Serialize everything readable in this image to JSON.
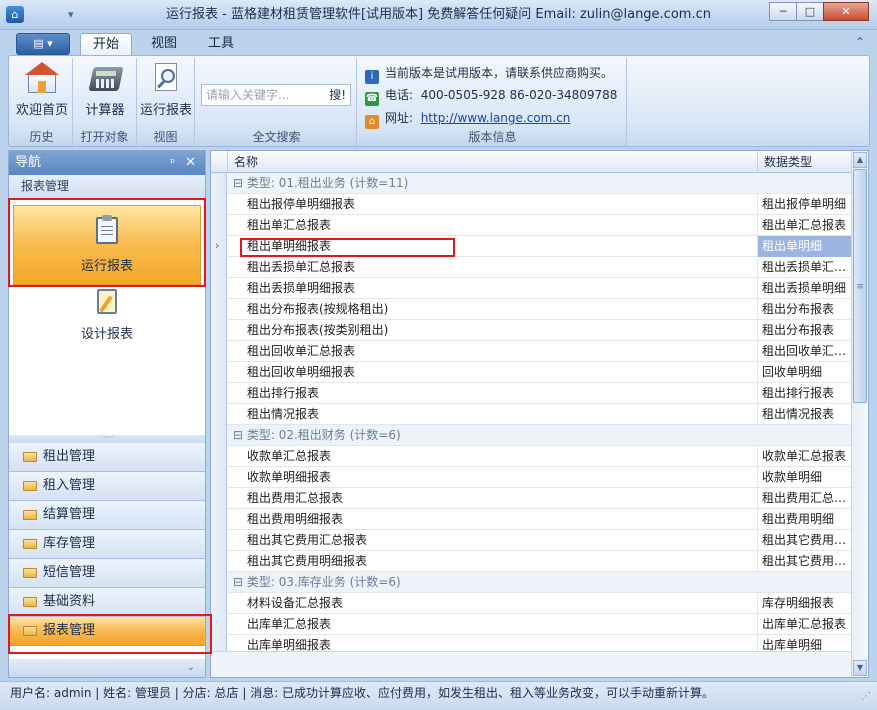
{
  "window": {
    "title": "运行报表 - 蓝格建材租赁管理软件[试用版本] 免费解答任何疑问 Email: zulin@lange.com.cn",
    "qat_symbol": "▾",
    "min_symbol": "─",
    "max_symbol": "□",
    "close_symbol": "✕"
  },
  "ribbon": {
    "app_menu_symbol": "▤ ▾",
    "tabs": [
      "开始",
      "视图",
      "工具"
    ],
    "collapse_symbol": "⌃",
    "groups": {
      "history": {
        "label": "历史",
        "button": "欢迎首页"
      },
      "open": {
        "label": "打开对象",
        "button": "计算器"
      },
      "view": {
        "label": "视图",
        "button": "运行报表"
      },
      "search": {
        "label": "全文搜索",
        "placeholder": "请输入关键字...",
        "go": "搜!"
      },
      "version": {
        "label": "版本信息",
        "notice": "当前版本是试用版本，请联系供应商购买。",
        "phone_label": "电话:",
        "phone_value": "400-0505-928  86-020-34809788",
        "site_label": "网址:",
        "site_value": "http://www.lange.com.cn"
      }
    }
  },
  "nav": {
    "title": "导航",
    "pin_symbol": "ᵖ",
    "close_symbol": "✕",
    "section": "报表管理",
    "big_items": [
      "运行报表",
      "设计报表"
    ],
    "splitter": "·····",
    "categories": [
      "租出管理",
      "租入管理",
      "结算管理",
      "库存管理",
      "短信管理",
      "基础资料",
      "报表管理"
    ],
    "more_symbol": "⌄"
  },
  "grid": {
    "columns": [
      "名称",
      "数据类型"
    ],
    "pointer": "›",
    "rows": [
      {
        "kind": "group",
        "name": "⊟ 类型: 01.租出业务 (计数=11)"
      },
      {
        "name": "租出报停单明细报表",
        "type": "租出报停单明细"
      },
      {
        "name": "租出单汇总报表",
        "type": "租出单汇总报表"
      },
      {
        "name": "租出单明细报表",
        "type": "租出单明细",
        "selected": true
      },
      {
        "name": "租出丢损单汇总报表",
        "type": "租出丢损单汇总报表"
      },
      {
        "name": "租出丢损单明细报表",
        "type": "租出丢损单明细"
      },
      {
        "name": "租出分布报表(按规格租出)",
        "type": "租出分布报表"
      },
      {
        "name": "租出分布报表(按类别租出)",
        "type": "租出分布报表"
      },
      {
        "name": "租出回收单汇总报表",
        "type": "租出回收单汇总报表"
      },
      {
        "name": "租出回收单明细报表",
        "type": "回收单明细"
      },
      {
        "name": "租出排行报表",
        "type": "租出排行报表"
      },
      {
        "name": "租出情况报表",
        "type": "租出情况报表"
      },
      {
        "kind": "group",
        "name": "⊟ 类型: 02.租出财务 (计数=6)"
      },
      {
        "name": "收款单汇总报表",
        "type": "收款单汇总报表"
      },
      {
        "name": "收款单明细报表",
        "type": "收款单明细"
      },
      {
        "name": "租出费用汇总报表",
        "type": "租出费用汇总报表"
      },
      {
        "name": "租出费用明细报表",
        "type": "租出费用明细"
      },
      {
        "name": "租出其它费用汇总报表",
        "type": "租出其它费用汇总报表"
      },
      {
        "name": "租出其它费用明细报表",
        "type": "租出其它费用明细"
      },
      {
        "kind": "group",
        "name": "⊟ 类型: 03.库存业务 (计数=6)"
      },
      {
        "name": "材料设备汇总报表",
        "type": "库存明细报表"
      },
      {
        "name": "出库单汇总报表",
        "type": "出库单汇总报表"
      },
      {
        "name": "出库单明细报表",
        "type": "出库单明细"
      }
    ],
    "scroll_up": "▲",
    "scroll_down": "▼",
    "thumb_grip": "≡"
  },
  "status": {
    "text": "用户名: admin  | 姓名: 管理员  | 分店: 总店  | 消息: 已成功计算应收、应付费用，如发生租出、租入等业务改变，可以手动重新计算。",
    "grip": "⋰"
  }
}
